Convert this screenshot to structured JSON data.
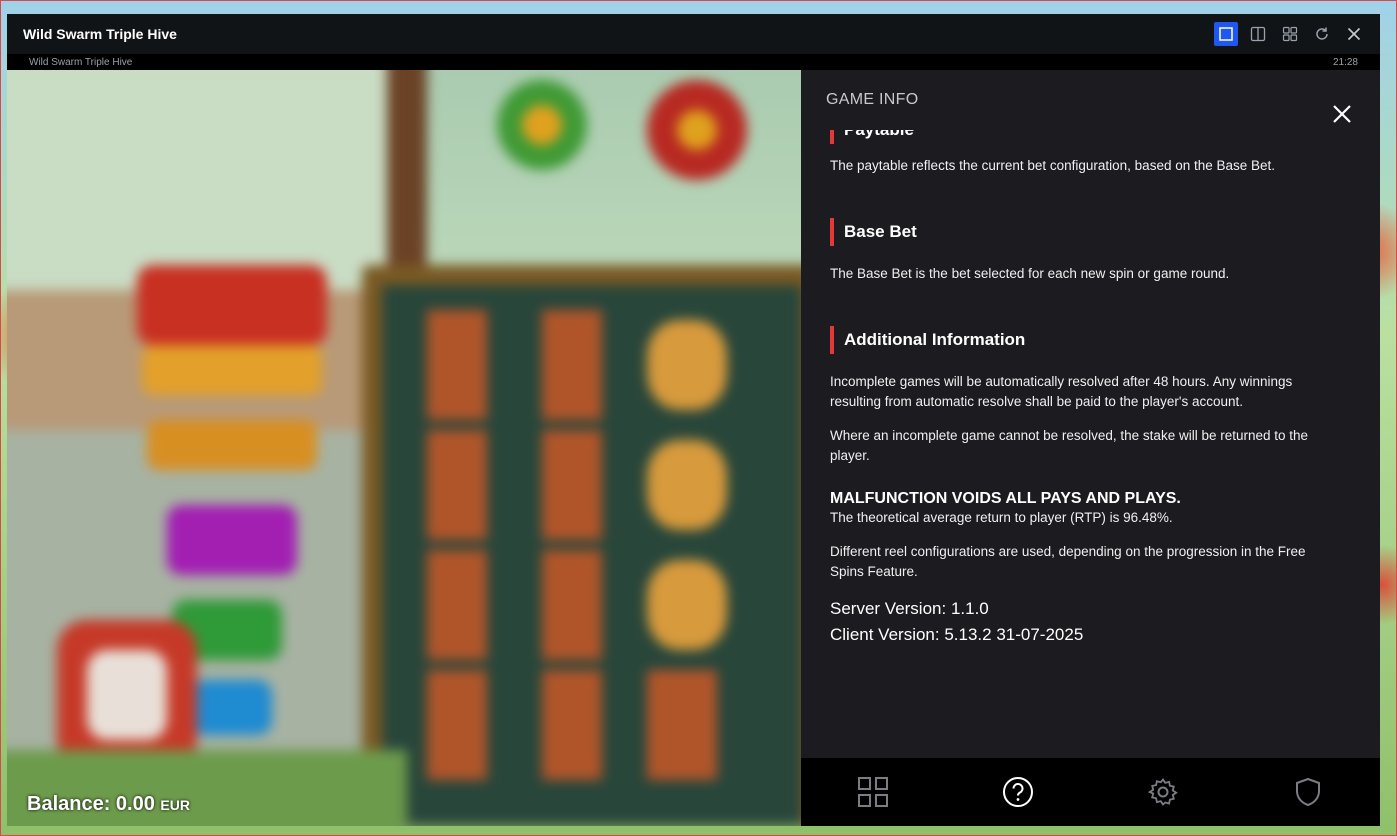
{
  "window": {
    "title": "Wild Swarm Triple Hive"
  },
  "titlebar_icons": [
    "single-view-icon",
    "split-view-icon",
    "grid-view-icon",
    "refresh-icon",
    "close-icon"
  ],
  "subbar": {
    "game_name": "Wild Swarm Triple Hive",
    "time": "21:28"
  },
  "balance": {
    "label": "Balance: 0.00",
    "currency": "EUR"
  },
  "panel": {
    "header": "GAME INFO",
    "partial_heading": "Paytable",
    "paytable_text": "The paytable reflects the current bet configuration, based on the Base Bet.",
    "sections": [
      {
        "title": "Base Bet",
        "paragraphs": [
          "The Base Bet is the bet selected for each new spin or game round."
        ]
      },
      {
        "title": "Additional Information",
        "paragraphs": [
          "Incomplete games will be automatically resolved after 48 hours. Any winnings resulting from automatic resolve shall be paid to the player's account.",
          "Where an incomplete game cannot be resolved, the stake will be returned to the player."
        ]
      }
    ],
    "malfunction": "MALFUNCTION VOIDS ALL PAYS AND PLAYS.",
    "rtp": "The theoretical average return to player (RTP) is 96.48%.",
    "reels": "Different reel configurations are used, depending on the progression in the Free Spins Feature.",
    "server_version": "Server Version: 1.1.0",
    "client_version": "Client Version: 5.13.2 31-07-2025"
  },
  "bottom_nav": [
    "menu-grid-icon",
    "help-icon",
    "settings-icon",
    "shield-icon"
  ],
  "colors": {
    "accent": "#e23838",
    "active_button": "#1f57f0",
    "panel_bg": "#1c1b20"
  }
}
